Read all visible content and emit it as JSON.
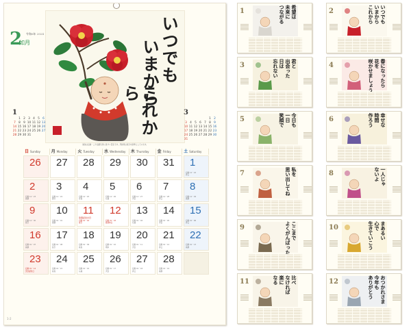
{
  "main": {
    "month_number": "2",
    "month_kanji": "如月",
    "month_year": "令和6年 2024",
    "poem": [
      "いつでも",
      "いまから",
      "これから"
    ],
    "mini_left": {
      "title": "1",
      "days": [
        "",
        "1",
        "2",
        "3",
        "4",
        "5",
        "6",
        "7",
        "8",
        "9",
        "10",
        "11",
        "12",
        "13",
        "14",
        "15",
        "16",
        "17",
        "18",
        "19",
        "20",
        "21",
        "22",
        "23",
        "24",
        "25",
        "26",
        "27",
        "28",
        "29",
        "30",
        "31",
        "",
        "",
        ""
      ]
    },
    "mini_right": {
      "title": "3",
      "days": [
        "",
        "",
        "",
        "",
        "",
        "1",
        "2",
        "3",
        "4",
        "5",
        "6",
        "7",
        "8",
        "9",
        "10",
        "11",
        "12",
        "13",
        "14",
        "15",
        "16",
        "17",
        "18",
        "19",
        "20",
        "21",
        "22",
        "23",
        "24",
        "25",
        "26",
        "27",
        "28",
        "29",
        "30",
        "31",
        ""
      ]
    },
    "notice": "暦注は旧暦・二十四節気等に基づく目安です。月齢等は東京を基準としています。",
    "weekdays": [
      {
        "kanji": "日",
        "en": "Sunday"
      },
      {
        "kanji": "月",
        "en": "Monday"
      },
      {
        "kanji": "火",
        "en": "Tuesday"
      },
      {
        "kanji": "水",
        "en": "Wednesday"
      },
      {
        "kanji": "木",
        "en": "Thursday"
      },
      {
        "kanji": "金",
        "en": "Friday"
      },
      {
        "kanji": "土",
        "en": "Saturday"
      }
    ],
    "days": [
      {
        "d": "26",
        "note": "",
        "hol": ""
      },
      {
        "d": "27",
        "note": "",
        "hol": ""
      },
      {
        "d": "28",
        "note": "",
        "hol": ""
      },
      {
        "d": "29",
        "note": "",
        "hol": ""
      },
      {
        "d": "30",
        "note": "",
        "hol": ""
      },
      {
        "d": "31",
        "note": "",
        "hol": ""
      },
      {
        "d": "1",
        "note": "旧暦 12・22\n赤口",
        "hol": ""
      },
      {
        "d": "2",
        "note": "旧暦 12・23\n先勝",
        "hol": ""
      },
      {
        "d": "3",
        "note": "旧暦 12・24\n節分",
        "hol": ""
      },
      {
        "d": "4",
        "note": "旧暦 12・25\n立春",
        "hol": ""
      },
      {
        "d": "5",
        "note": "旧暦 12・26\n仏滅",
        "hol": ""
      },
      {
        "d": "6",
        "note": "旧暦 12・27\n大安",
        "hol": ""
      },
      {
        "d": "7",
        "note": "旧暦 12・28\n赤口",
        "hol": ""
      },
      {
        "d": "8",
        "note": "旧暦 12・29\n先勝",
        "hol": ""
      },
      {
        "d": "9",
        "note": "旧暦 12・30\n友引",
        "hol": ""
      },
      {
        "d": "10",
        "note": "旧暦 01・01\n先勝",
        "hol": ""
      },
      {
        "d": "11",
        "note": "旧暦 01・02\n友引",
        "hol": "建国記念の日"
      },
      {
        "d": "12",
        "note": "旧暦 01・03\n振替休日",
        "hol": ""
      },
      {
        "d": "13",
        "note": "旧暦 01・04\n仏滅",
        "hol": ""
      },
      {
        "d": "14",
        "note": "旧暦 01・05\n大安",
        "hol": ""
      },
      {
        "d": "15",
        "note": "旧暦 01・06\n赤口",
        "hol": ""
      },
      {
        "d": "16",
        "note": "旧暦 01・07\n先勝",
        "hol": ""
      },
      {
        "d": "17",
        "note": "旧暦 01・08\n友引",
        "hol": ""
      },
      {
        "d": "18",
        "note": "旧暦 01・09\n先負",
        "hol": ""
      },
      {
        "d": "19",
        "note": "旧暦 01・10\n雨水",
        "hol": ""
      },
      {
        "d": "20",
        "note": "旧暦 01・11\n大安",
        "hol": ""
      },
      {
        "d": "21",
        "note": "旧暦 01・12\n赤口",
        "hol": ""
      },
      {
        "d": "22",
        "note": "旧暦 01・13\n先勝",
        "hol": ""
      },
      {
        "d": "23",
        "note": "旧暦 01・14\n天皇誕生日",
        "hol": ""
      },
      {
        "d": "24",
        "note": "旧暦 01・15\n先負",
        "hol": ""
      },
      {
        "d": "25",
        "note": "旧暦 01・16\n仏滅",
        "hol": ""
      },
      {
        "d": "26",
        "note": "旧暦 01・17\n大安",
        "hol": ""
      },
      {
        "d": "27",
        "note": "旧暦 01・18\n赤口",
        "hol": ""
      },
      {
        "d": "28",
        "note": "旧暦 01・19\n先勝",
        "hol": ""
      },
      {
        "d": "",
        "note": "",
        "hol": ""
      }
    ],
    "page_no": "1-2"
  },
  "thumbnails": [
    {
      "num": "1",
      "text": [
        "希望は",
        "未来に",
        "つながる"
      ]
    },
    {
      "num": "2",
      "text": [
        "いつでも",
        "いまから",
        "これから"
      ]
    },
    {
      "num": "3",
      "text": [
        "君と",
        "出会った",
        "日は",
        "忘れない"
      ]
    },
    {
      "num": "4",
      "text": [
        "春になったら",
        "花を",
        "咲かせましょう"
      ]
    },
    {
      "num": "5",
      "text": [
        "今日も",
        "一日",
        "笑顔で"
      ]
    },
    {
      "num": "6",
      "text": [
        "幸せな",
        "時間",
        "作ろう"
      ]
    },
    {
      "num": "7",
      "text": [
        "私を",
        "思い出してね"
      ]
    },
    {
      "num": "8",
      "text": [
        "一人じゃ",
        "ないよ"
      ]
    },
    {
      "num": "9",
      "text": [
        "ここまで",
        "よくがんばったね"
      ]
    },
    {
      "num": "10",
      "text": [
        "まあるい",
        "心で",
        "生きていこう"
      ]
    },
    {
      "num": "11",
      "text": [
        "比べ",
        "なければ",
        "楽に",
        "なる"
      ]
    },
    {
      "num": "12",
      "text": [
        "おつかれさま",
        "今年も",
        "ありがとう"
      ]
    }
  ]
}
